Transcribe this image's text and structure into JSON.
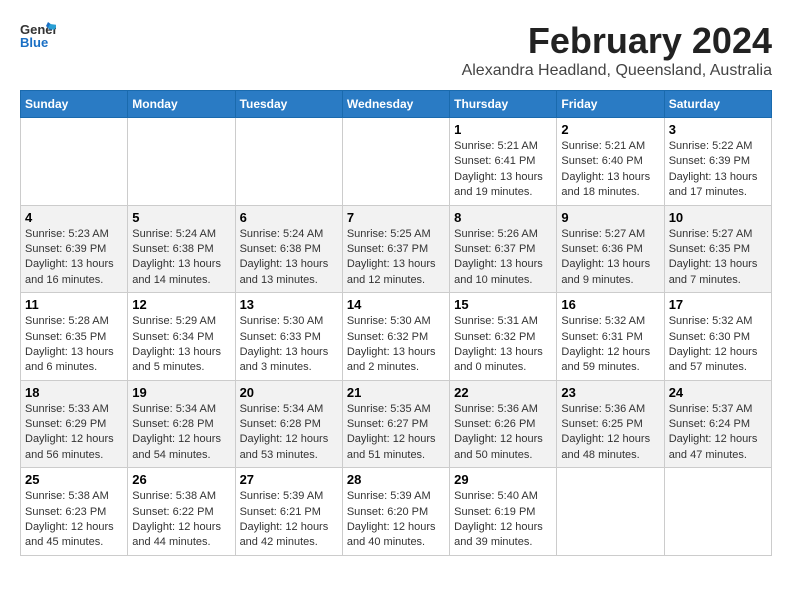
{
  "logo": {
    "general": "General",
    "blue": "Blue"
  },
  "header": {
    "month": "February 2024",
    "location": "Alexandra Headland, Queensland, Australia"
  },
  "weekdays": [
    "Sunday",
    "Monday",
    "Tuesday",
    "Wednesday",
    "Thursday",
    "Friday",
    "Saturday"
  ],
  "weeks": [
    [
      {
        "day": "",
        "info": ""
      },
      {
        "day": "",
        "info": ""
      },
      {
        "day": "",
        "info": ""
      },
      {
        "day": "",
        "info": ""
      },
      {
        "day": "1",
        "info": "Sunrise: 5:21 AM\nSunset: 6:41 PM\nDaylight: 13 hours\nand 19 minutes."
      },
      {
        "day": "2",
        "info": "Sunrise: 5:21 AM\nSunset: 6:40 PM\nDaylight: 13 hours\nand 18 minutes."
      },
      {
        "day": "3",
        "info": "Sunrise: 5:22 AM\nSunset: 6:39 PM\nDaylight: 13 hours\nand 17 minutes."
      }
    ],
    [
      {
        "day": "4",
        "info": "Sunrise: 5:23 AM\nSunset: 6:39 PM\nDaylight: 13 hours\nand 16 minutes."
      },
      {
        "day": "5",
        "info": "Sunrise: 5:24 AM\nSunset: 6:38 PM\nDaylight: 13 hours\nand 14 minutes."
      },
      {
        "day": "6",
        "info": "Sunrise: 5:24 AM\nSunset: 6:38 PM\nDaylight: 13 hours\nand 13 minutes."
      },
      {
        "day": "7",
        "info": "Sunrise: 5:25 AM\nSunset: 6:37 PM\nDaylight: 13 hours\nand 12 minutes."
      },
      {
        "day": "8",
        "info": "Sunrise: 5:26 AM\nSunset: 6:37 PM\nDaylight: 13 hours\nand 10 minutes."
      },
      {
        "day": "9",
        "info": "Sunrise: 5:27 AM\nSunset: 6:36 PM\nDaylight: 13 hours\nand 9 minutes."
      },
      {
        "day": "10",
        "info": "Sunrise: 5:27 AM\nSunset: 6:35 PM\nDaylight: 13 hours\nand 7 minutes."
      }
    ],
    [
      {
        "day": "11",
        "info": "Sunrise: 5:28 AM\nSunset: 6:35 PM\nDaylight: 13 hours\nand 6 minutes."
      },
      {
        "day": "12",
        "info": "Sunrise: 5:29 AM\nSunset: 6:34 PM\nDaylight: 13 hours\nand 5 minutes."
      },
      {
        "day": "13",
        "info": "Sunrise: 5:30 AM\nSunset: 6:33 PM\nDaylight: 13 hours\nand 3 minutes."
      },
      {
        "day": "14",
        "info": "Sunrise: 5:30 AM\nSunset: 6:32 PM\nDaylight: 13 hours\nand 2 minutes."
      },
      {
        "day": "15",
        "info": "Sunrise: 5:31 AM\nSunset: 6:32 PM\nDaylight: 13 hours\nand 0 minutes."
      },
      {
        "day": "16",
        "info": "Sunrise: 5:32 AM\nSunset: 6:31 PM\nDaylight: 12 hours\nand 59 minutes."
      },
      {
        "day": "17",
        "info": "Sunrise: 5:32 AM\nSunset: 6:30 PM\nDaylight: 12 hours\nand 57 minutes."
      }
    ],
    [
      {
        "day": "18",
        "info": "Sunrise: 5:33 AM\nSunset: 6:29 PM\nDaylight: 12 hours\nand 56 minutes."
      },
      {
        "day": "19",
        "info": "Sunrise: 5:34 AM\nSunset: 6:28 PM\nDaylight: 12 hours\nand 54 minutes."
      },
      {
        "day": "20",
        "info": "Sunrise: 5:34 AM\nSunset: 6:28 PM\nDaylight: 12 hours\nand 53 minutes."
      },
      {
        "day": "21",
        "info": "Sunrise: 5:35 AM\nSunset: 6:27 PM\nDaylight: 12 hours\nand 51 minutes."
      },
      {
        "day": "22",
        "info": "Sunrise: 5:36 AM\nSunset: 6:26 PM\nDaylight: 12 hours\nand 50 minutes."
      },
      {
        "day": "23",
        "info": "Sunrise: 5:36 AM\nSunset: 6:25 PM\nDaylight: 12 hours\nand 48 minutes."
      },
      {
        "day": "24",
        "info": "Sunrise: 5:37 AM\nSunset: 6:24 PM\nDaylight: 12 hours\nand 47 minutes."
      }
    ],
    [
      {
        "day": "25",
        "info": "Sunrise: 5:38 AM\nSunset: 6:23 PM\nDaylight: 12 hours\nand 45 minutes."
      },
      {
        "day": "26",
        "info": "Sunrise: 5:38 AM\nSunset: 6:22 PM\nDaylight: 12 hours\nand 44 minutes."
      },
      {
        "day": "27",
        "info": "Sunrise: 5:39 AM\nSunset: 6:21 PM\nDaylight: 12 hours\nand 42 minutes."
      },
      {
        "day": "28",
        "info": "Sunrise: 5:39 AM\nSunset: 6:20 PM\nDaylight: 12 hours\nand 40 minutes."
      },
      {
        "day": "29",
        "info": "Sunrise: 5:40 AM\nSunset: 6:19 PM\nDaylight: 12 hours\nand 39 minutes."
      },
      {
        "day": "",
        "info": ""
      },
      {
        "day": "",
        "info": ""
      }
    ]
  ]
}
